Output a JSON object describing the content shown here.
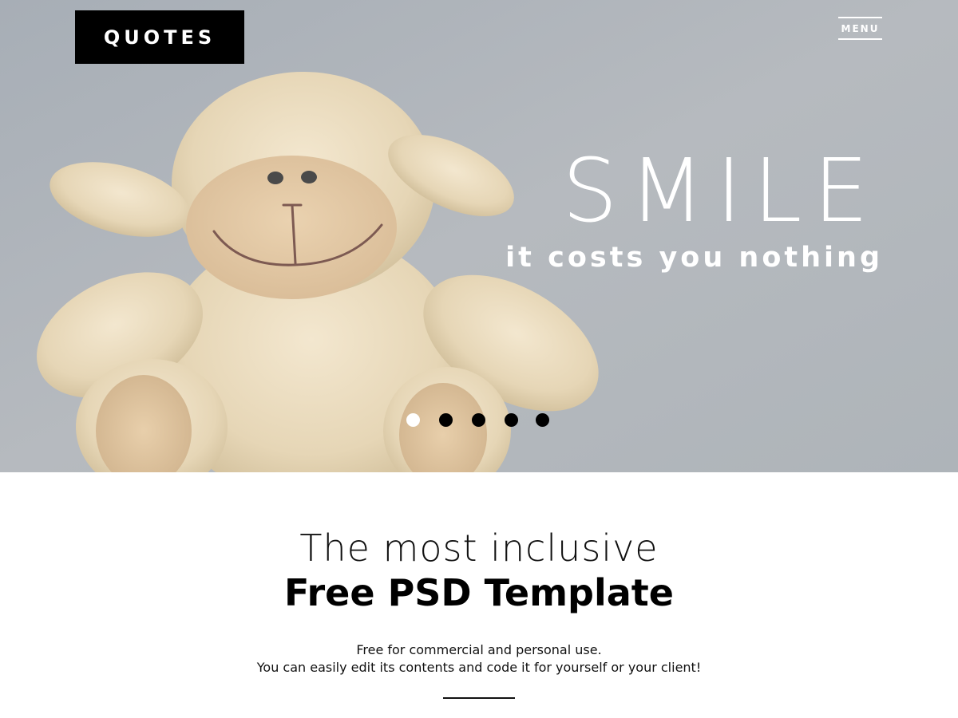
{
  "header": {
    "logo_text": "QUOTES",
    "menu_label": "MENU"
  },
  "hero": {
    "title": "SMILE",
    "subtitle": "it costs you nothing",
    "image": "teddy-sheep-plush-photo",
    "slider": {
      "total": 5,
      "active_index": 0
    }
  },
  "intro": {
    "heading_light": "The most inclusive",
    "heading_bold": "Free PSD Template",
    "line1": "Free for commercial and personal use.",
    "line2": "You can easily edit its contents and code it for yourself or your client!"
  },
  "colors": {
    "hero_background": "#b4b8bd",
    "logo_background": "#000000",
    "text_light": "#ffffff",
    "text_dark": "#111111"
  },
  "icons": {
    "menu": "hamburger-menu-icon"
  }
}
